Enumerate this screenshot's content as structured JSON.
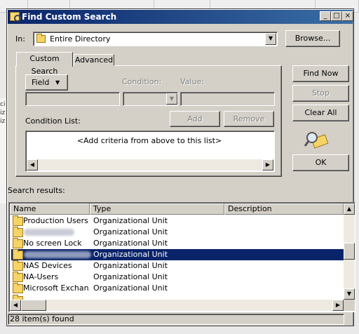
{
  "window": {
    "title": "Find Custom Search",
    "caption_buttons": [
      "_",
      "□",
      "×"
    ]
  },
  "in_label": "In:",
  "in_value": "Entire Directory",
  "browse_label": "Browse...",
  "tabs": [
    {
      "label": "Custom Search",
      "active": true
    },
    {
      "label": "Advanced",
      "active": false
    }
  ],
  "field_button_label": "Field",
  "condition_label": "Condition:",
  "value_label": "Value:",
  "add_label": "Add",
  "remove_label": "Remove",
  "condition_list_label": "Condition List:",
  "condition_list_text": "<Add criteria from above to this list>",
  "actions": {
    "find_now": "Find Now",
    "stop": "Stop",
    "clear_all": "Clear All",
    "ok": "OK"
  },
  "search_results_label": "Search results:",
  "columns": [
    "Name",
    "Type",
    "Description"
  ],
  "rows": [
    {
      "name": "Production Users",
      "type": "Organizational Unit",
      "selected": false
    },
    {
      "name": "",
      "type": "Organizational Unit",
      "selected": false
    },
    {
      "name": "No screen Lock",
      "type": "Organizational Unit",
      "selected": false
    },
    {
      "name": "",
      "type": "Organizational Unit",
      "selected": true
    },
    {
      "name": "NAS Devices",
      "type": "Organizational Unit",
      "selected": false
    },
    {
      "name": "NA-Users",
      "type": "Organizational Unit",
      "selected": false
    },
    {
      "name": "Microsoft Exchan...",
      "type": "Organizational Unit",
      "selected": false
    }
  ],
  "status": "28 item(s) found",
  "background_side_text": "ci iz iz"
}
